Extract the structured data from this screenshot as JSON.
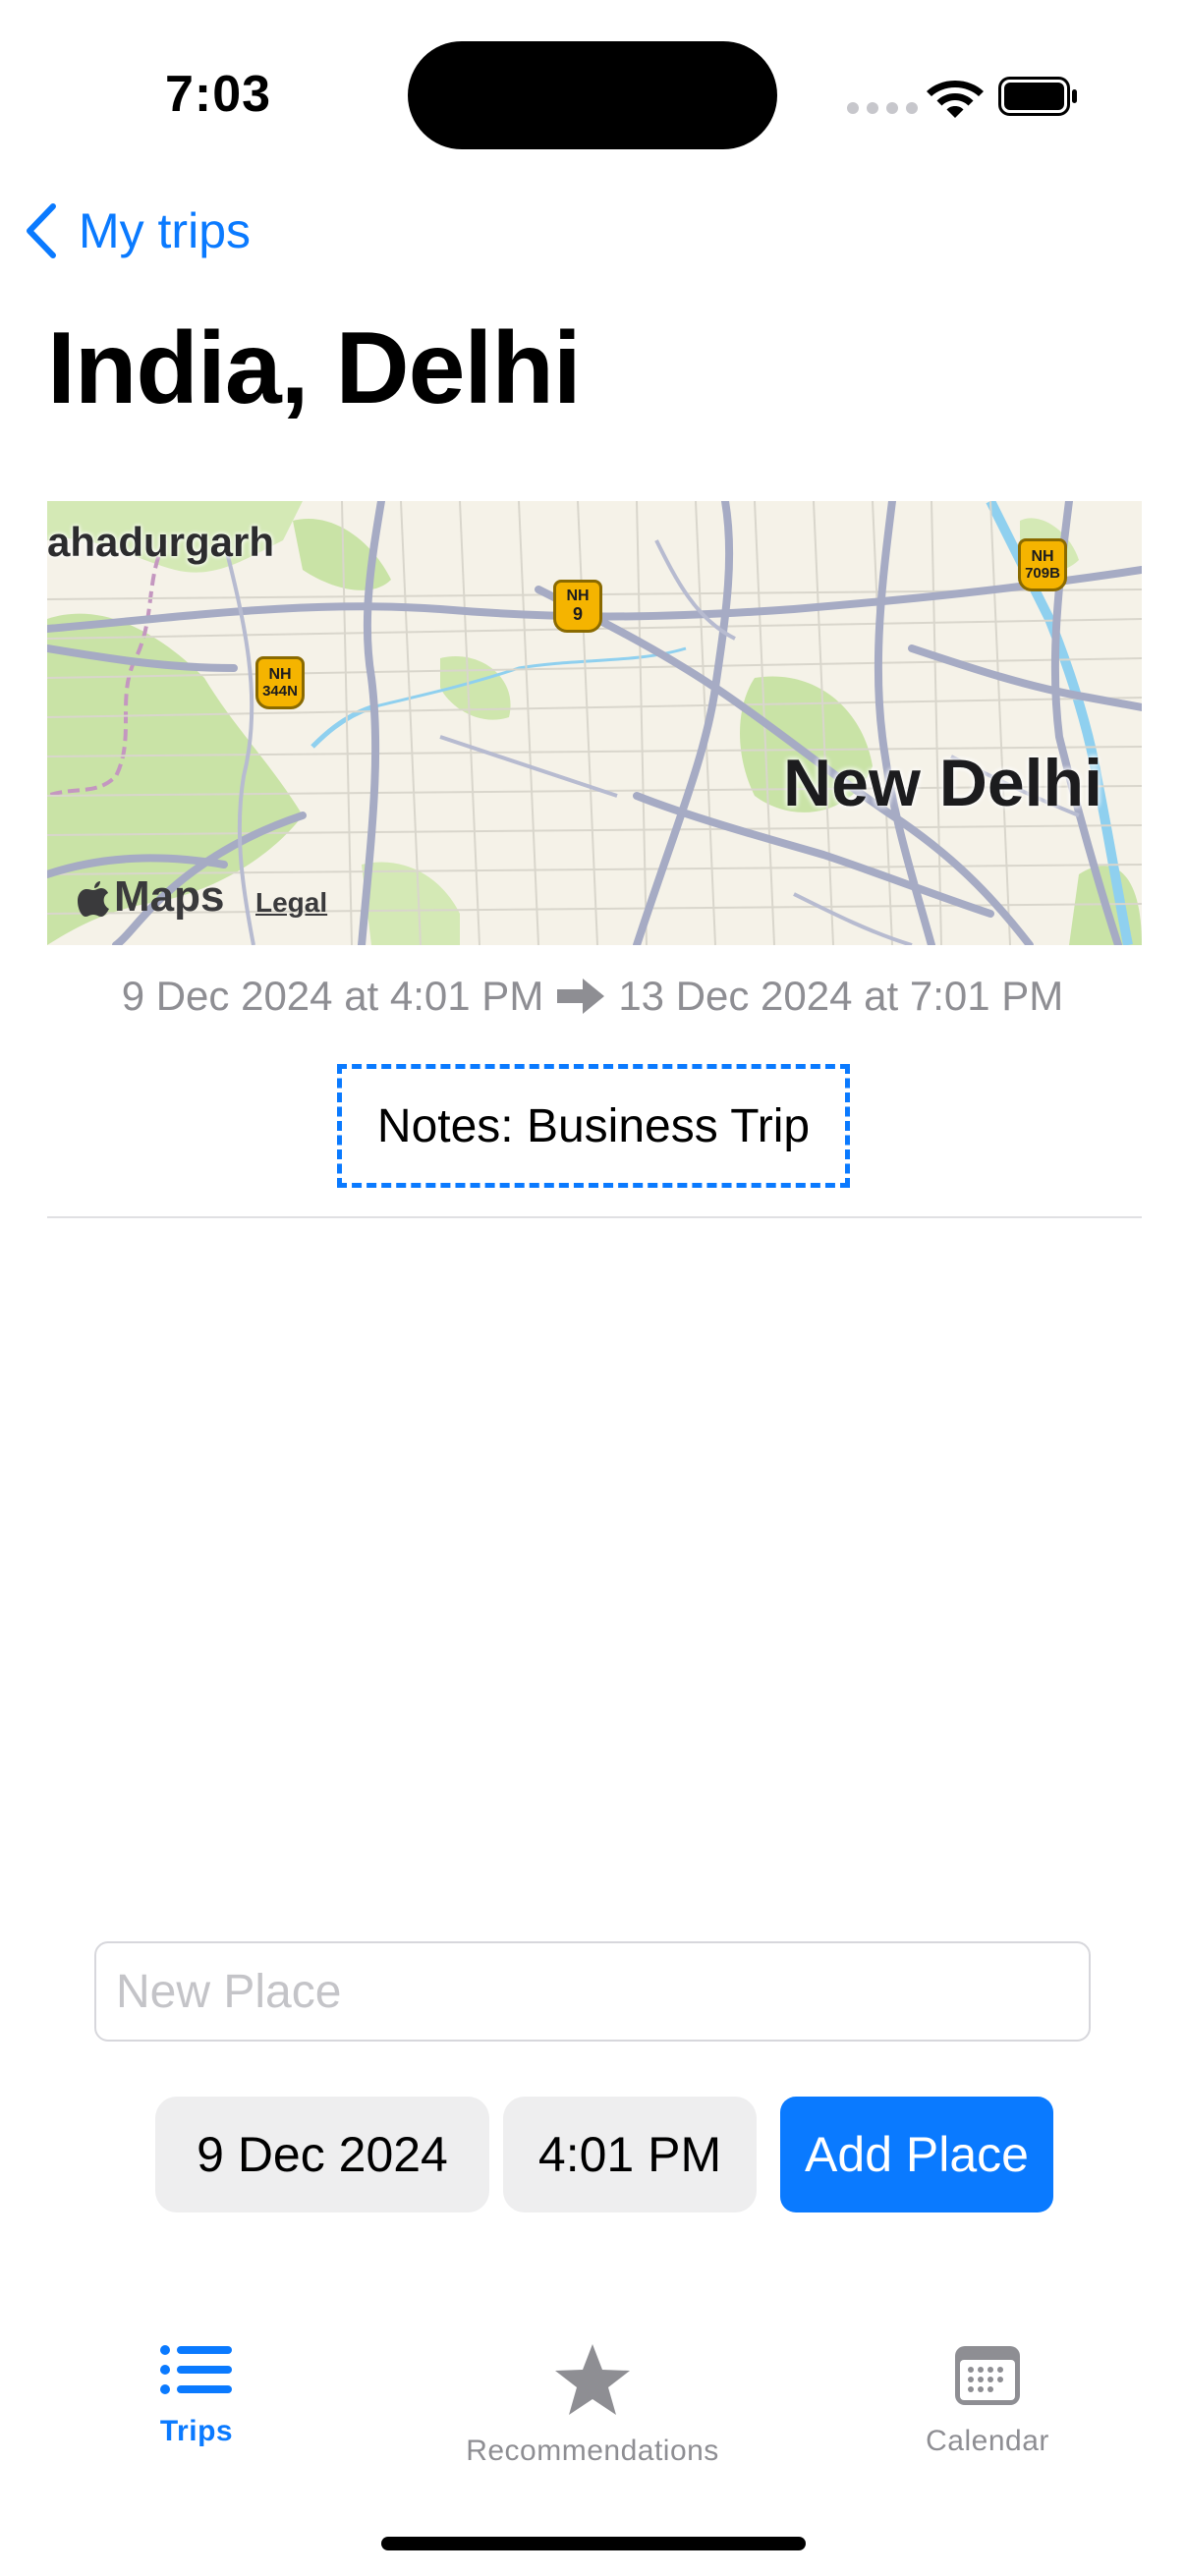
{
  "status_bar": {
    "time": "7:03"
  },
  "nav": {
    "back_label": "My trips",
    "title": "India, Delhi"
  },
  "map": {
    "city_label": "New Delhi",
    "town_label": "ahadurgarh",
    "logo_text": "Maps",
    "legal_text": "Legal",
    "shields": [
      {
        "top": "NH",
        "num": "9"
      },
      {
        "top": "NH",
        "num": "344N"
      },
      {
        "top": "NH",
        "num": "709B"
      }
    ]
  },
  "trip": {
    "start": "9 Dec 2024 at 4:01 PM",
    "end": "13 Dec 2024 at 7:01 PM",
    "notes": "Notes: Business Trip"
  },
  "new_place": {
    "placeholder": "New Place",
    "value": "",
    "date": "9 Dec 2024",
    "time": "4:01 PM",
    "add_label": "Add Place"
  },
  "tabs": [
    {
      "label": "Trips",
      "icon": "list-icon",
      "active": true
    },
    {
      "label": "Recommendations",
      "icon": "star-icon",
      "active": false
    },
    {
      "label": "Calendar",
      "icon": "calendar-icon",
      "active": false
    }
  ],
  "colors": {
    "accent": "#0a7aff",
    "secondary_text": "#8e8e93"
  }
}
